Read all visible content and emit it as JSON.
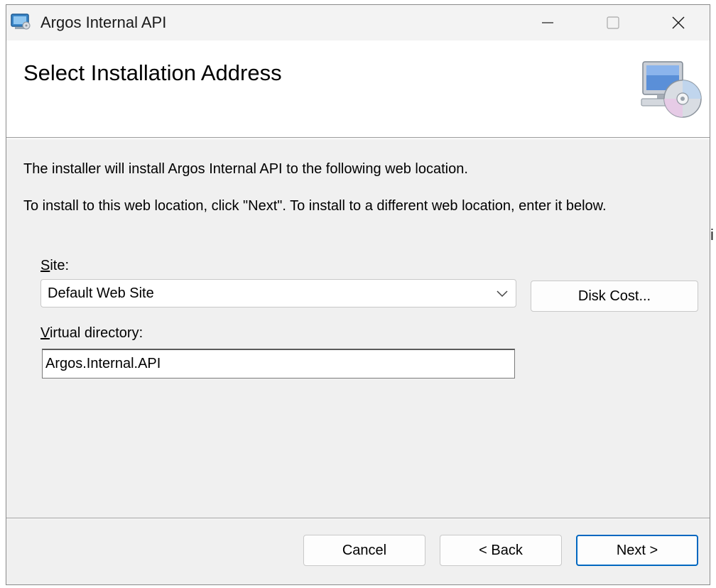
{
  "window": {
    "title": "Argos Internal API"
  },
  "header": {
    "title": "Select Installation Address"
  },
  "body": {
    "description_1": "The installer will install Argos Internal API to the following web location.",
    "description_2": "To install to this web location, click \"Next\". To install to a different web location, enter it below."
  },
  "site": {
    "label_accel": "S",
    "label_rest": "ite:",
    "selected": "Default Web Site"
  },
  "virtual_directory": {
    "label_accel": "V",
    "label_rest": "irtual directory:",
    "value": "Argos.Internal.API"
  },
  "buttons": {
    "disk_cost": "Disk Cost...",
    "cancel": "Cancel",
    "back": "< Back",
    "next": "Next >"
  },
  "icons": {
    "app": "installer-app-icon",
    "header": "computer-cd-icon",
    "minimize": "minimize-icon",
    "maximize": "maximize-icon",
    "close": "close-icon",
    "dropdown": "chevron-down-icon"
  },
  "colors": {
    "window_bg": "#f0f0f0",
    "header_bg": "#ffffff",
    "default_button_border": "#0067c0"
  }
}
